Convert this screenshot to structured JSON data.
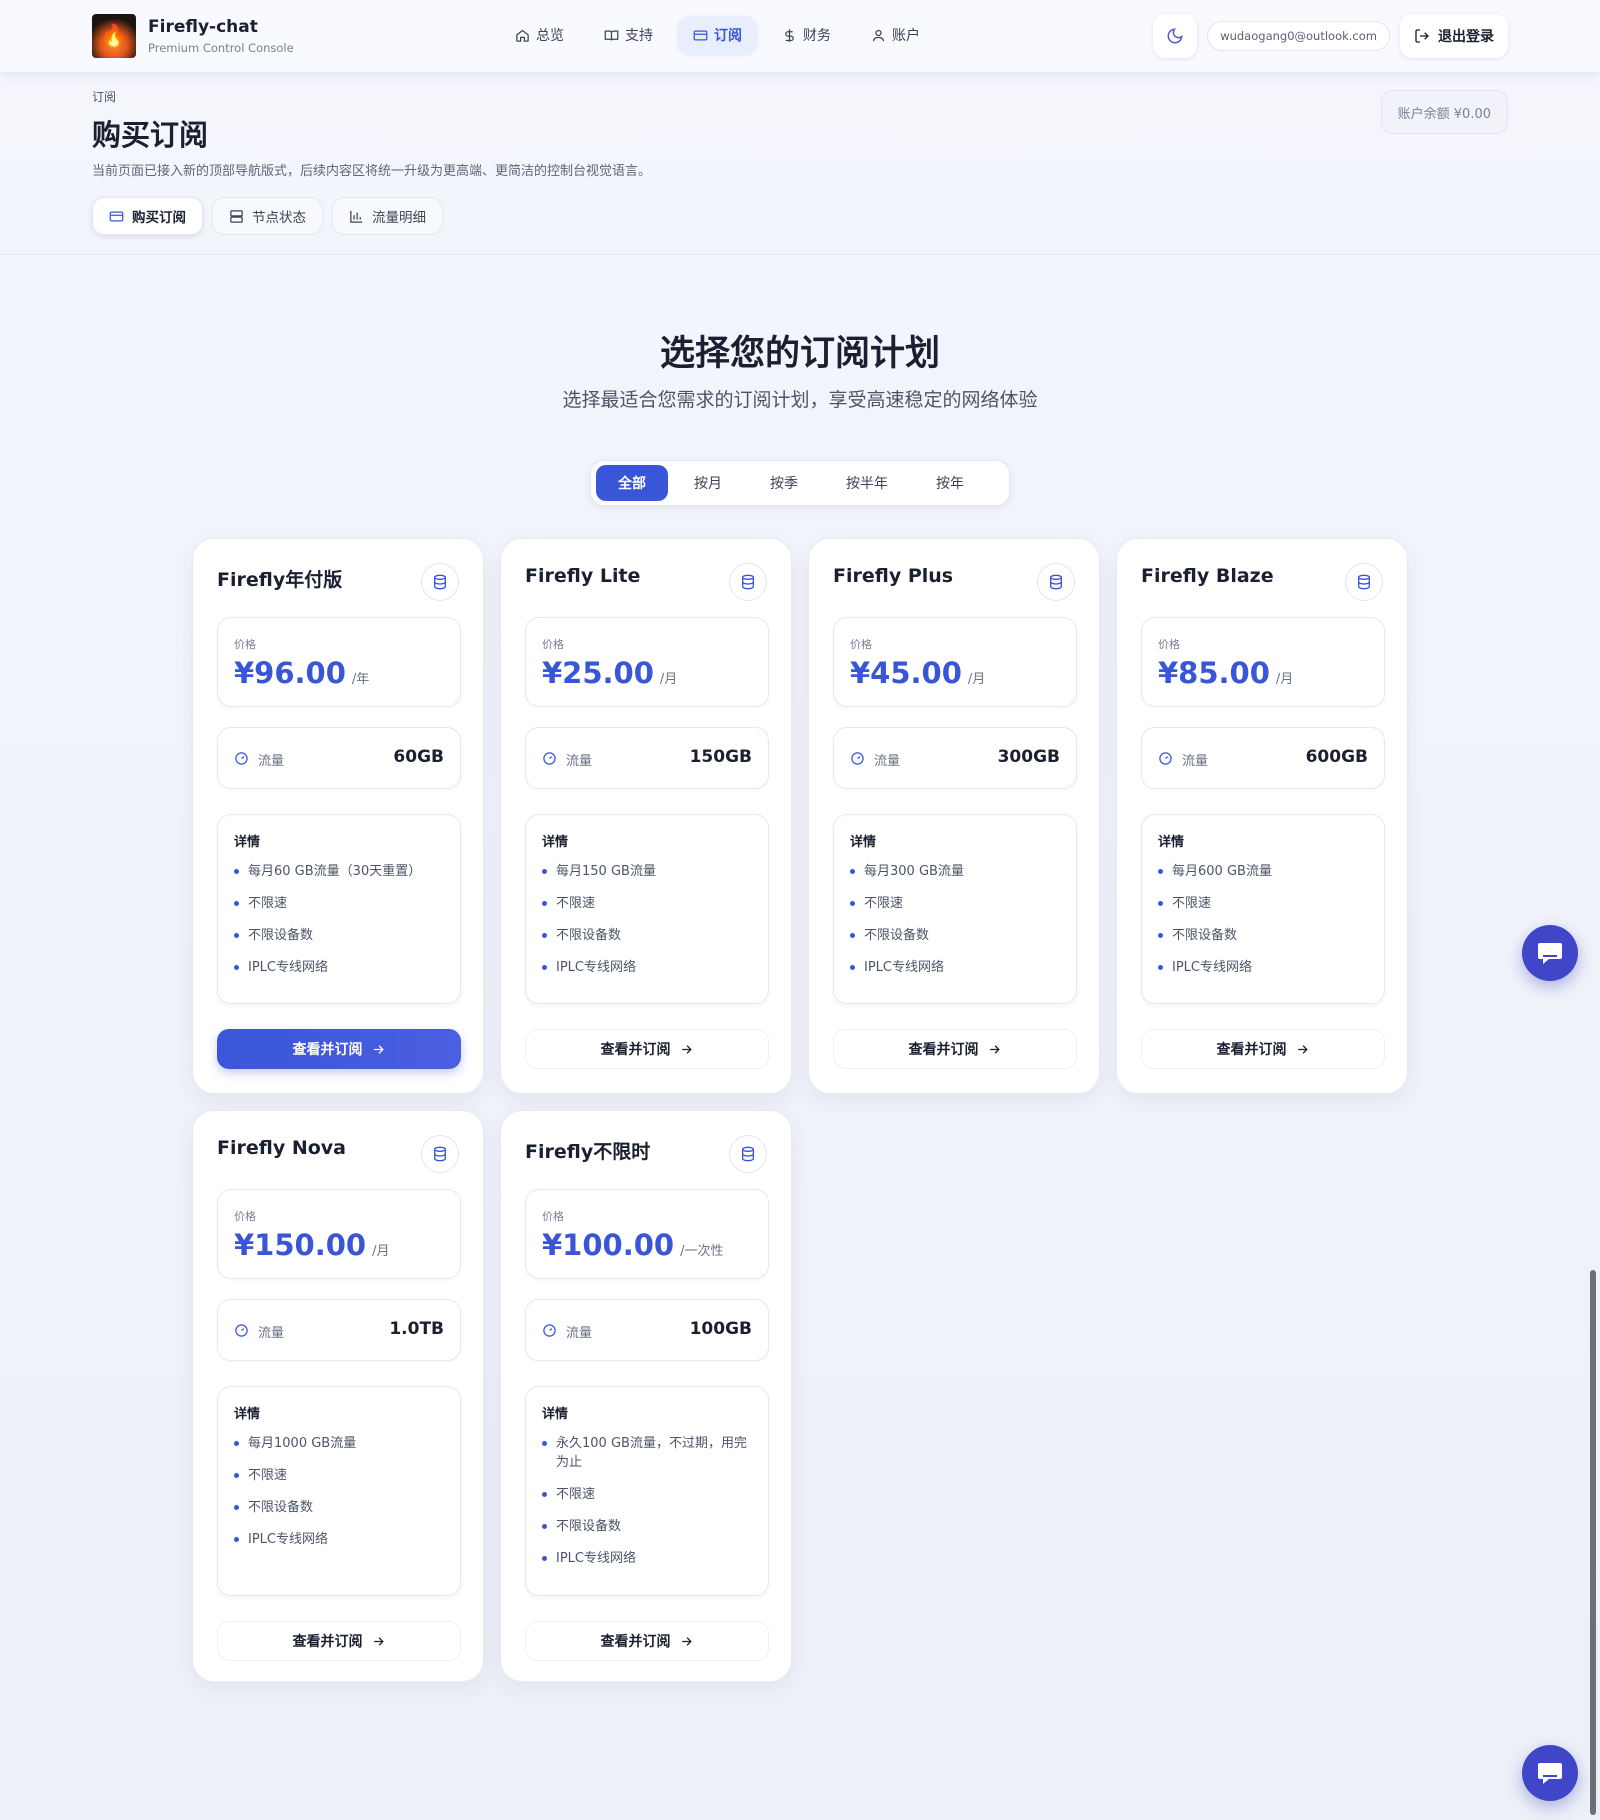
{
  "brand": {
    "name": "Firefly-chat",
    "subtitle": "Premium Control Console"
  },
  "nav": [
    {
      "label": "总览",
      "icon": "home-icon"
    },
    {
      "label": "支持",
      "icon": "book-icon"
    },
    {
      "label": "订阅",
      "icon": "card-icon",
      "active": true
    },
    {
      "label": "财务",
      "icon": "dollar-icon"
    },
    {
      "label": "账户",
      "icon": "user-icon"
    }
  ],
  "user": {
    "email": "wudaogang0@outlook.com",
    "logout_label": "退出登录"
  },
  "page": {
    "breadcrumb": "订阅",
    "title": "购买订阅",
    "description": "当前页面已接入新的顶部导航版式，后续内容区将统一升级为更高端、更简洁的控制台视觉语言。",
    "balance": "账户余额 ¥0.00",
    "subtabs": [
      {
        "label": "购买订阅",
        "icon": "card-icon",
        "active": true
      },
      {
        "label": "节点状态",
        "icon": "server-icon"
      },
      {
        "label": "流量明细",
        "icon": "bar-chart-icon"
      }
    ]
  },
  "plans": {
    "title": "选择您的订阅计划",
    "subtitle": "选择最适合您需求的订阅计划，享受高速稳定的网络体验",
    "periods": [
      {
        "label": "全部",
        "active": true
      },
      {
        "label": "按月"
      },
      {
        "label": "按季"
      },
      {
        "label": "按半年"
      },
      {
        "label": "按年"
      }
    ],
    "price_label": "价格",
    "traffic_label": "流量",
    "detail_label": "详情",
    "cta_label": "查看并订阅",
    "items": [
      {
        "name": "Firefly年付版",
        "price": "¥96.00",
        "unit": "/年",
        "traffic": "60GB",
        "details": [
          "每月60 GB流量（30天重置）",
          "不限速",
          "不限设备数",
          "IPLC专线网络"
        ],
        "primary": true
      },
      {
        "name": "Firefly Lite",
        "price": "¥25.00",
        "unit": "/月",
        "traffic": "150GB",
        "details": [
          "每月150 GB流量",
          "不限速",
          "不限设备数",
          "IPLC专线网络"
        ]
      },
      {
        "name": "Firefly Plus",
        "price": "¥45.00",
        "unit": "/月",
        "traffic": "300GB",
        "details": [
          "每月300 GB流量",
          "不限速",
          "不限设备数",
          "IPLC专线网络"
        ]
      },
      {
        "name": "Firefly Blaze",
        "price": "¥85.00",
        "unit": "/月",
        "traffic": "600GB",
        "details": [
          "每月600 GB流量",
          "不限速",
          "不限设备数",
          "IPLC专线网络"
        ]
      },
      {
        "name": "Firefly Nova",
        "price": "¥150.00",
        "unit": "/月",
        "traffic": "1.0TB",
        "details": [
          "每月1000 GB流量",
          "不限速",
          "不限设备数",
          "IPLC专线网络"
        ]
      },
      {
        "name": "Firefly不限时",
        "price": "¥100.00",
        "unit": "/一次性",
        "traffic": "100GB",
        "details": [
          "永久100 GB流量，不过期，用完为止",
          "不限速",
          "不限设备数",
          "IPLC专线网络"
        ]
      }
    ]
  },
  "colors": {
    "accent": "#3a56d8",
    "chat_fab": "#3f47c8"
  }
}
